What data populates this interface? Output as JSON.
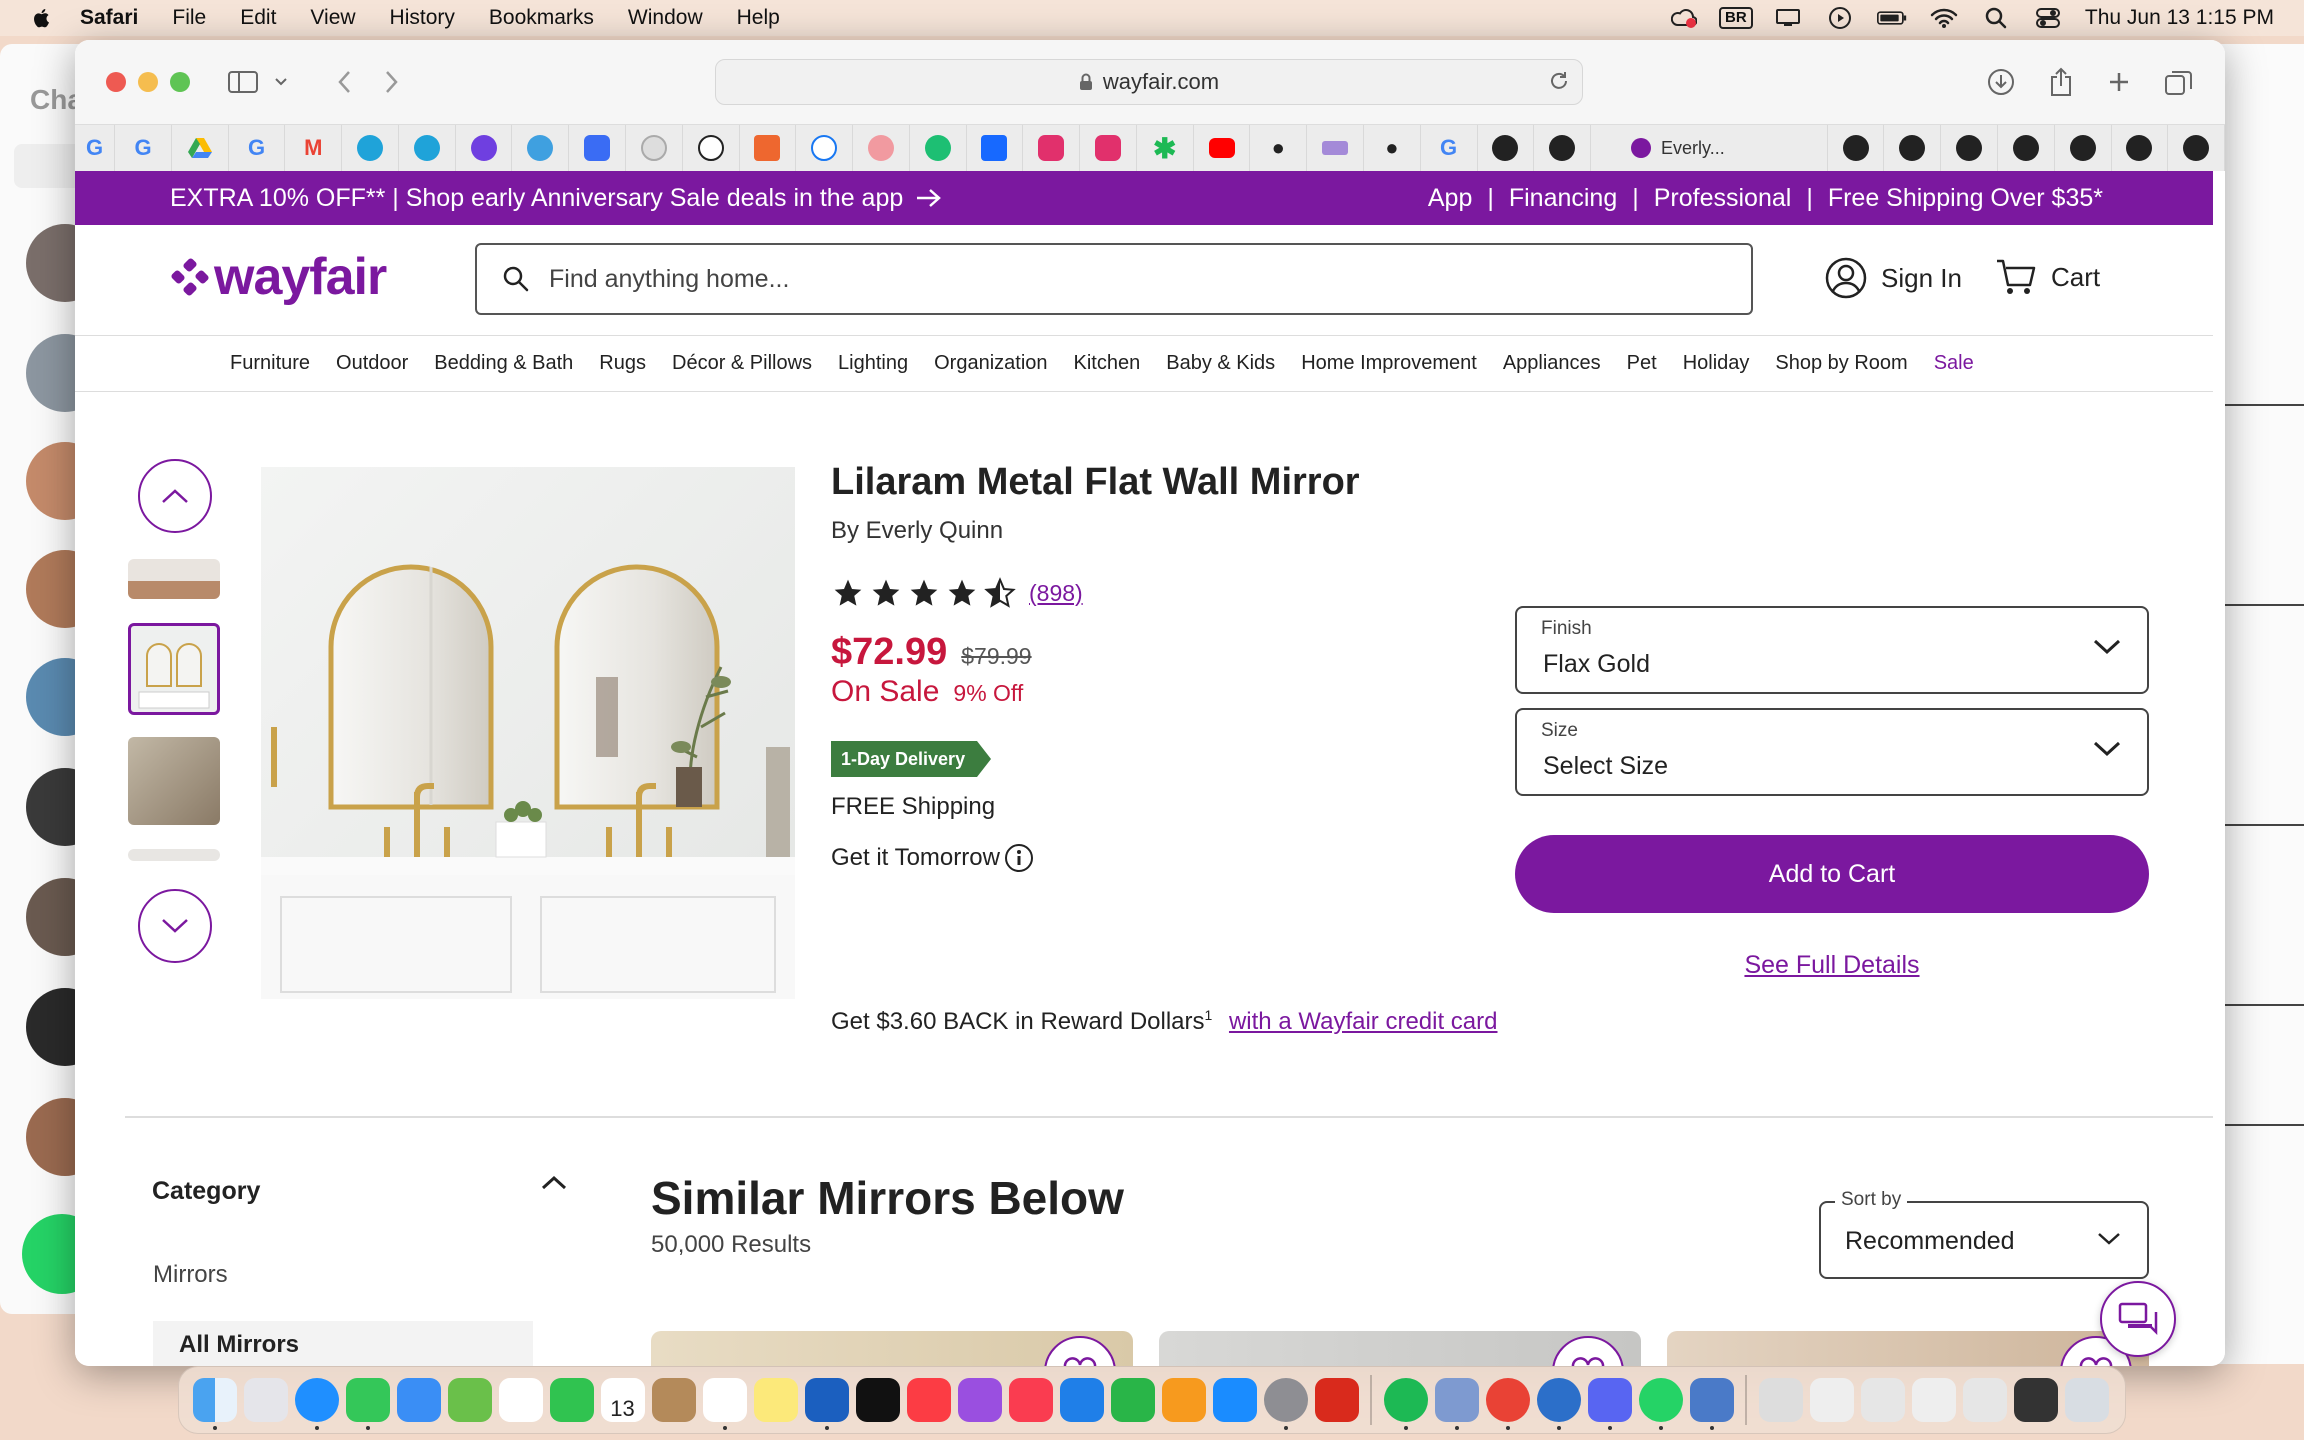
{
  "menubar": {
    "app_name": "Safari",
    "items": [
      "File",
      "Edit",
      "View",
      "History",
      "Bookmarks",
      "Window",
      "Help"
    ],
    "input_badge": "BR",
    "datetime": "Thu Jun 13  1:15 PM"
  },
  "background_app": {
    "title_fragment": "Cha"
  },
  "browser": {
    "url": "wayfair.com",
    "tab_title": "Everly..."
  },
  "promo": {
    "left_text": "EXTRA 10% OFF** | Shop early Anniversary Sale deals in the app",
    "links": [
      "App",
      "Financing",
      "Professional",
      "Free Shipping Over $35*"
    ]
  },
  "header": {
    "logo_text": "wayfair",
    "search_placeholder": "Find anything home...",
    "sign_in": "Sign In",
    "cart": "Cart"
  },
  "nav": {
    "items": [
      "Furniture",
      "Outdoor",
      "Bedding & Bath",
      "Rugs",
      "Décor & Pillows",
      "Lighting",
      "Organization",
      "Kitchen",
      "Baby & Kids",
      "Home Improvement",
      "Appliances",
      "Pet",
      "Holiday",
      "Shop by Room",
      "Sale"
    ]
  },
  "product": {
    "title": "Lilaram Metal Flat Wall Mirror",
    "brand": "By Everly Quinn",
    "rating": 4.5,
    "review_count": "(898)",
    "price": "$72.99",
    "original_price": "$79.99",
    "sale_label": "On Sale",
    "discount": "9% Off",
    "delivery_badge": "1-Day Delivery",
    "shipping": "FREE Shipping",
    "arrival": "Get it Tomorrow",
    "reward_text": "Get $3.60 BACK in Reward Dollars",
    "reward_sup": "1",
    "reward_link": "with a Wayfair credit card",
    "finish": {
      "label": "Finish",
      "value": "Flax Gold"
    },
    "size": {
      "label": "Size",
      "value": "Select Size"
    },
    "add_to_cart": "Add to Cart",
    "see_details": "See Full Details"
  },
  "filters": {
    "category_heading": "Category",
    "category_item": "Mirrors",
    "category_selected": "All Mirrors"
  },
  "similar": {
    "title": "Similar Mirrors Below",
    "results": "50,000 Results",
    "sort_label": "Sort by",
    "sort_value": "Recommended"
  },
  "dock": {
    "calendar_day": "13"
  },
  "colors": {
    "brand_purple": "#7b189f",
    "sale_red": "#c7173d",
    "delivery_green": "#3c7d3f"
  }
}
